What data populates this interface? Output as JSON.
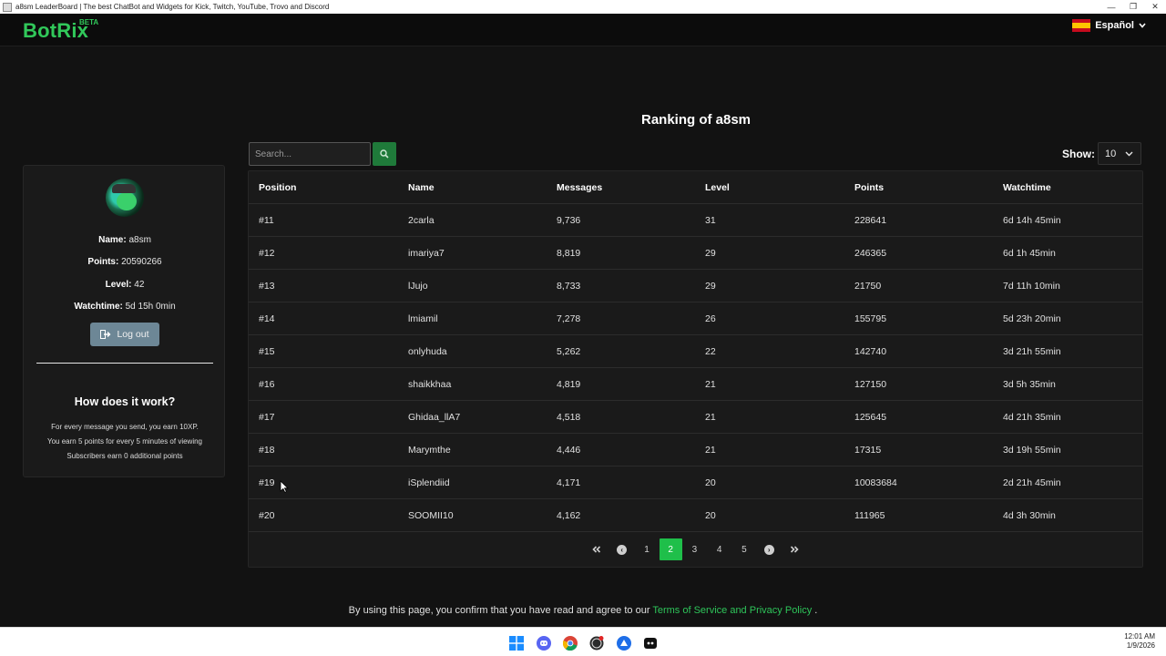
{
  "window": {
    "title": "a8sm LeaderBoard | The best ChatBot and Widgets for Kick, Twitch, YouTube, Trovo and Discord"
  },
  "navbar": {
    "logo": "BotRix",
    "beta": "BETA",
    "language": "Español"
  },
  "page": {
    "title": "Ranking of a8sm"
  },
  "profile": {
    "name_label": "Name:",
    "name": "a8sm",
    "points_label": "Points:",
    "points": "20590266",
    "level_label": "Level:",
    "level": "42",
    "watchtime_label": "Watchtime:",
    "watchtime": "5d 15h 0min",
    "logout_label": "Log out"
  },
  "how": {
    "title": "How does it work?",
    "lines": [
      "For every message you send, you earn 10XP.",
      "You earn 5 points for every 5 minutes of viewing",
      "Subscribers earn 0 additional points"
    ]
  },
  "search": {
    "placeholder": "Search..."
  },
  "show": {
    "label": "Show:",
    "value": "10"
  },
  "table": {
    "headers": [
      "Position",
      "Name",
      "Messages",
      "Level",
      "Points",
      "Watchtime"
    ],
    "rows": [
      [
        "#11",
        "2carla",
        "9,736",
        "31",
        "228641",
        "6d 14h 45min"
      ],
      [
        "#12",
        "imariya7",
        "8,819",
        "29",
        "246365",
        "6d 1h 45min"
      ],
      [
        "#13",
        "lJujo",
        "8,733",
        "29",
        "21750",
        "7d 11h 10min"
      ],
      [
        "#14",
        "lmiamil",
        "7,278",
        "26",
        "155795",
        "5d 23h 20min"
      ],
      [
        "#15",
        "onlyhuda",
        "5,262",
        "22",
        "142740",
        "3d 21h 55min"
      ],
      [
        "#16",
        "shaikkhaa",
        "4,819",
        "21",
        "127150",
        "3d 5h 35min"
      ],
      [
        "#17",
        "Ghidaa_llA7",
        "4,518",
        "21",
        "125645",
        "4d 21h 35min"
      ],
      [
        "#18",
        "Marymthe",
        "4,446",
        "21",
        "17315",
        "3d 19h 55min"
      ],
      [
        "#19",
        "iSplendiid",
        "4,171",
        "20",
        "10083684",
        "2d 21h 45min"
      ],
      [
        "#20",
        "SOOMII10",
        "4,162",
        "20",
        "111965",
        "4d 3h 30min"
      ]
    ]
  },
  "pagination": {
    "first": "«",
    "prev": "‹",
    "pages": [
      "1",
      "2",
      "3",
      "4",
      "5"
    ],
    "current": "2",
    "next": "›",
    "last": "»"
  },
  "footer": {
    "text": "By using this page, you confirm that you have read and agree to our",
    "link": "Terms of Service and Privacy Policy",
    "end": "."
  },
  "taskbar": {
    "time": "12:01 AM",
    "date": "1/9/2026"
  },
  "colors": {
    "brand": "#31c85a",
    "active_page": "#1fbf4a",
    "logout_button": "#6d8796",
    "background": "#121212"
  }
}
